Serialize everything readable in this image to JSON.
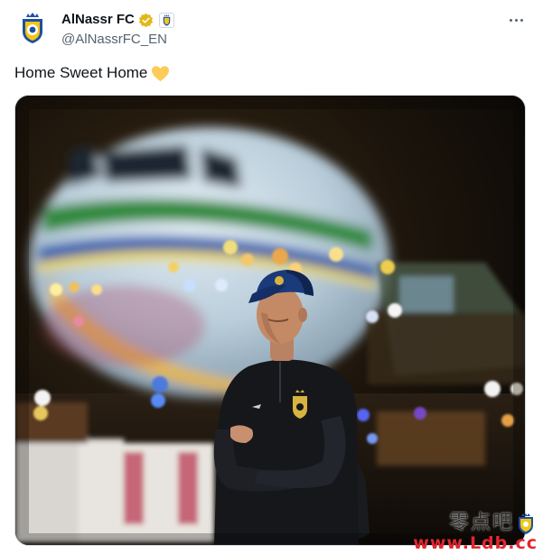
{
  "account": {
    "display_name": "AlNassr FC",
    "handle": "@AlNassrFC_EN",
    "avatar_icon": "alnassr-crest-icon",
    "verified_icon": "gold-verified-badge-icon",
    "affiliate_icon": "affiliate-badge-icon",
    "verified_color": "#e2b719"
  },
  "menu": {
    "icon": "more-options-icon"
  },
  "post": {
    "text": "Home Sweet Home",
    "emoji": "💛"
  },
  "media": {
    "kind": "photo",
    "subject_icon": "player-at-airplane-photo"
  },
  "watermark": {
    "line1": "零点吧",
    "line2": "www.Ldb.cc"
  },
  "colors": {
    "text_primary": "#0f1419",
    "text_secondary": "#536471",
    "border": "#cfd9de",
    "watermark_red": "#e3262d"
  }
}
